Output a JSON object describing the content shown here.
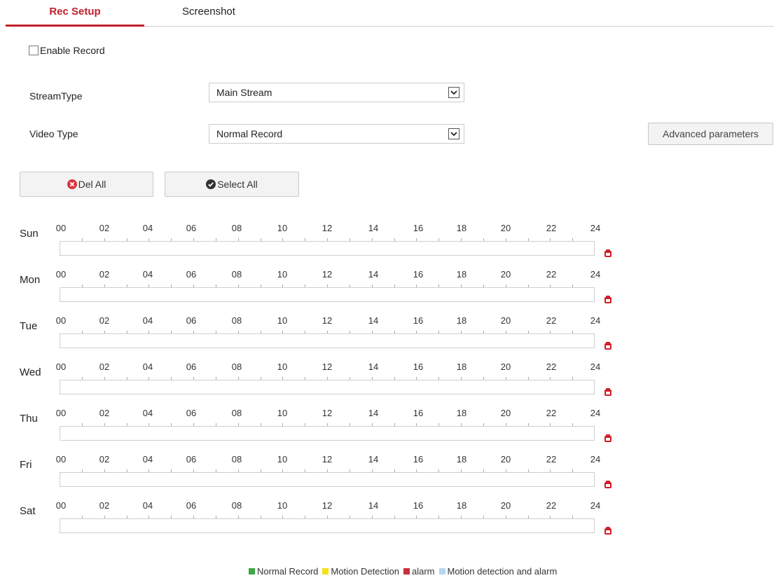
{
  "tabs": [
    {
      "label": "Rec Setup",
      "active": true
    },
    {
      "label": "Screenshot",
      "active": false
    }
  ],
  "enable_record": {
    "label": "Enable Record",
    "checked": false
  },
  "stream_type": {
    "label": "StreamType",
    "value": "Main Stream"
  },
  "video_type": {
    "label": "Video Type",
    "value": "Normal Record"
  },
  "advanced_button": "Advanced parameters",
  "del_all_button": "Del All",
  "select_all_button": "Select All",
  "hours": [
    "00",
    "02",
    "04",
    "06",
    "08",
    "10",
    "12",
    "14",
    "16",
    "18",
    "20",
    "22",
    "24"
  ],
  "days": [
    "Sun",
    "Mon",
    "Tue",
    "Wed",
    "Thu",
    "Fri",
    "Sat"
  ],
  "legend": [
    {
      "label": "Normal Record",
      "color": "#3aa845"
    },
    {
      "label": "Motion Detection",
      "color": "#f5e11a"
    },
    {
      "label": "alarm",
      "color": "#c8303a"
    },
    {
      "label": "Motion detection and alarm",
      "color": "#b7d6f0"
    }
  ],
  "colors": {
    "accent": "#c0202a"
  },
  "icons": {
    "erase": "eraser-icon",
    "del": "close-circle-icon",
    "select": "check-circle-icon",
    "dropdown": "chevron-down-icon"
  }
}
